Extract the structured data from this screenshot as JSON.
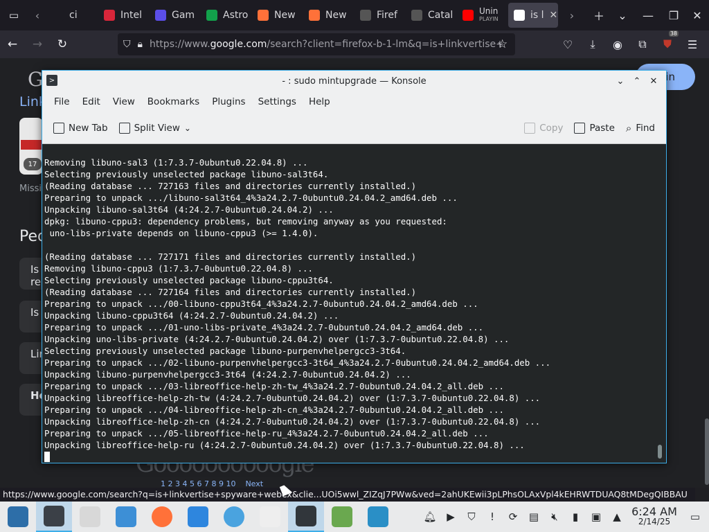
{
  "browser": {
    "tabs": [
      {
        "label": "ci",
        "icon": "generic-tab-icon",
        "color": "#1c1b22"
      },
      {
        "label": "Intel",
        "icon": "p-site-icon",
        "color": "#d9263a"
      },
      {
        "label": "Gam",
        "icon": "controller-icon",
        "color": "#5b4ee8"
      },
      {
        "label": "Astro",
        "icon": "astro-icon",
        "color": "#12a14b"
      },
      {
        "label": "New",
        "icon": "firefox-icon",
        "color": "#ff7139"
      },
      {
        "label": "New",
        "icon": "firefox-icon",
        "color": "#ff7139"
      },
      {
        "label": "Firef",
        "icon": "firefox-support-icon",
        "color": "#555"
      },
      {
        "label": "Catal",
        "icon": "catalog-icon",
        "color": "#555"
      },
      {
        "label": "Unin",
        "sub": "PLAYIN",
        "icon": "youtube-icon",
        "color": "#ff0000"
      },
      {
        "label": "is l",
        "icon": "google-icon",
        "color": "#ffffff",
        "active": true
      }
    ],
    "url_prefix": "https://www.",
    "url_domain": "google.com",
    "url_rest": "/search?client=firefox-b-1-lm&q=is+linkvertise+",
    "extension_badge": "38",
    "status_url": "https://www.google.com/search?q=is+linkvertise+spyware+webex&clie...UOi5wwl_ZIZqJ7PWw&ved=2ahUKEwii3pLPhsOLAxVpl4kEHRWTDUAQ8tMDegQIBBAU"
  },
  "google": {
    "signin": "n in",
    "logo_fragment": "G",
    "link_fragment": "Link",
    "thumb_number": "17",
    "missing_fragment": "Missi",
    "people_fragment": "Peo",
    "question_cards": [
      "Is\nre",
      "Is",
      "Lir",
      "Ho"
    ],
    "pager": "Goooooooooogle",
    "pager_numbers": "1 2 3 4 5 6 7 8 9 10    Next"
  },
  "konsole": {
    "title": "- : sudo mintupgrade — Konsole",
    "menu": [
      "File",
      "Edit",
      "View",
      "Bookmarks",
      "Plugins",
      "Settings",
      "Help"
    ],
    "toolbar": {
      "new_tab": "New Tab",
      "split_view": "Split View",
      "copy": "Copy",
      "paste": "Paste",
      "find": "Find"
    },
    "lines": [
      "Removing libuno-sal3 (1:7.3.7-0ubuntu0.22.04.8) ...",
      "Selecting previously unselected package libuno-sal3t64.",
      "(Reading database ... 727163 files and directories currently installed.)",
      "Preparing to unpack .../libuno-sal3t64_4%3a24.2.7-0ubuntu0.24.04.2_amd64.deb ...",
      "Unpacking libuno-sal3t64 (4:24.2.7-0ubuntu0.24.04.2) ...",
      "dpkg: libuno-cppu3: dependency problems, but removing anyway as you requested:",
      " uno-libs-private depends on libuno-cppu3 (>= 1.4.0).",
      "",
      "(Reading database ... 727171 files and directories currently installed.)",
      "Removing libuno-cppu3 (1:7.3.7-0ubuntu0.22.04.8) ...",
      "Selecting previously unselected package libuno-cppu3t64.",
      "(Reading database ... 727164 files and directories currently installed.)",
      "Preparing to unpack .../00-libuno-cppu3t64_4%3a24.2.7-0ubuntu0.24.04.2_amd64.deb ...",
      "Unpacking libuno-cppu3t64 (4:24.2.7-0ubuntu0.24.04.2) ...",
      "Preparing to unpack .../01-uno-libs-private_4%3a24.2.7-0ubuntu0.24.04.2_amd64.deb ...",
      "Unpacking uno-libs-private (4:24.2.7-0ubuntu0.24.04.2) over (1:7.3.7-0ubuntu0.22.04.8) ...",
      "Selecting previously unselected package libuno-purpenvhelpergcc3-3t64.",
      "Preparing to unpack .../02-libuno-purpenvhelpergcc3-3t64_4%3a24.2.7-0ubuntu0.24.04.2_amd64.deb ...",
      "Unpacking libuno-purpenvhelpergcc3-3t64 (4:24.2.7-0ubuntu0.24.04.2) ...",
      "Preparing to unpack .../03-libreoffice-help-zh-tw_4%3a24.2.7-0ubuntu0.24.04.2_all.deb ...",
      "Unpacking libreoffice-help-zh-tw (4:24.2.7-0ubuntu0.24.04.2) over (1:7.3.7-0ubuntu0.22.04.8) ...",
      "Preparing to unpack .../04-libreoffice-help-zh-cn_4%3a24.2.7-0ubuntu0.24.04.2_all.deb ...",
      "Unpacking libreoffice-help-zh-cn (4:24.2.7-0ubuntu0.24.04.2) over (1:7.3.7-0ubuntu0.22.04.8) ...",
      "Preparing to unpack .../05-libreoffice-help-ru_4%3a24.2.7-0ubuntu0.24.04.2_all.deb ...",
      "Unpacking libreoffice-help-ru (4:24.2.7-0ubuntu0.24.04.2) over (1:7.3.7-0ubuntu0.22.04.8) ..."
    ]
  },
  "taskbar": {
    "apps": [
      {
        "name": "application-launcher",
        "color": "#2d6ea8"
      },
      {
        "name": "system-settings",
        "color": "#3b4047",
        "active": true
      },
      {
        "name": "files",
        "color": "#d8d8d8"
      },
      {
        "name": "dolphin",
        "color": "#3d8fd6"
      },
      {
        "name": "firefox",
        "color": "#ff7139"
      },
      {
        "name": "discover",
        "color": "#2e86de"
      },
      {
        "name": "web-browser",
        "color": "#4aa3df"
      },
      {
        "name": "vpn-shield",
        "color": "#eeeeee"
      },
      {
        "name": "konsole",
        "color": "#31363b",
        "active": true
      },
      {
        "name": "updater",
        "color": "#6aa84f"
      },
      {
        "name": "system-monitor",
        "color": "#2a8fc6"
      }
    ],
    "clock_time": "6:24 AM",
    "clock_date": "2/14/25"
  }
}
